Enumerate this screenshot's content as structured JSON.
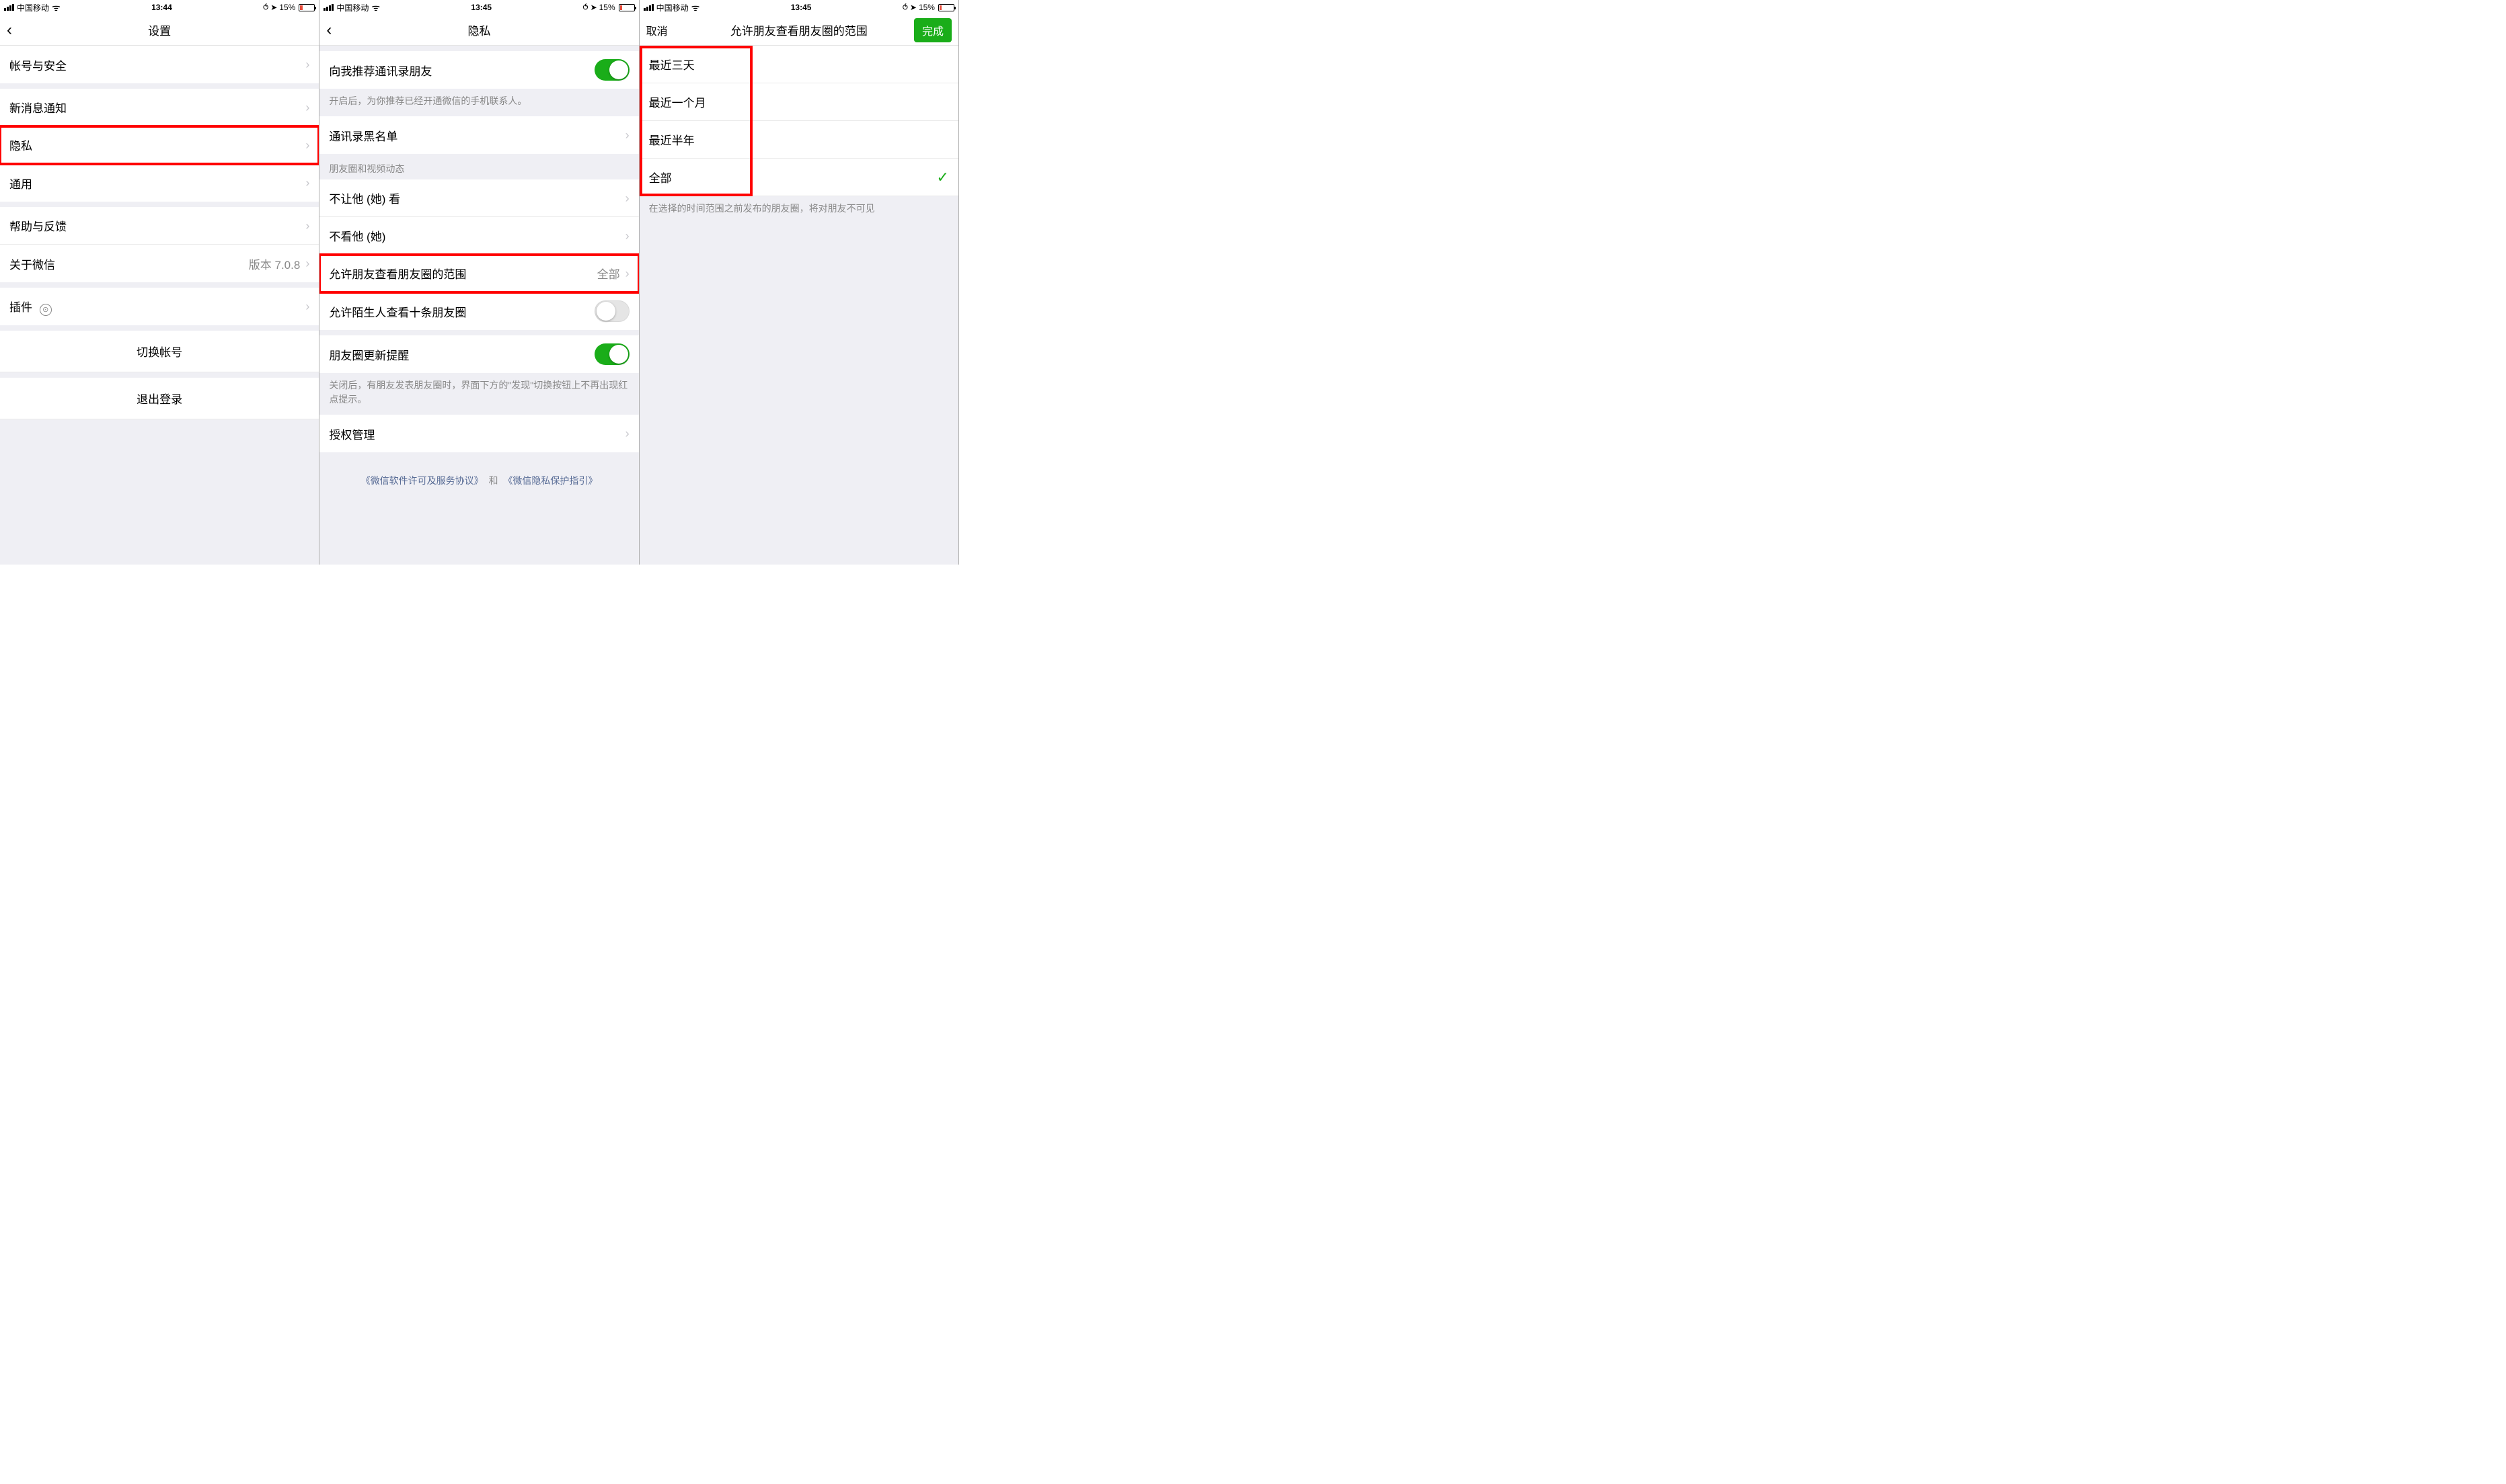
{
  "statusbar": {
    "carrier": "中国移动",
    "battery_pct": "15%",
    "battery_width": "15%",
    "time1": "13:44",
    "time2": "13:45",
    "time3": "13:45"
  },
  "icons": {
    "chevron_right": "›",
    "chevron_left": "‹",
    "wifi": "ᯤ",
    "lock_rotation": "⥀",
    "location": "➤",
    "check": "✓"
  },
  "screen1": {
    "title": "设置",
    "items": {
      "account": "帐号与安全",
      "notifications": "新消息通知",
      "privacy": "隐私",
      "general": "通用",
      "help": "帮助与反馈",
      "about": "关于微信",
      "about_value": "版本 7.0.8",
      "plugins": "插件",
      "switch": "切换帐号",
      "logout": "退出登录"
    }
  },
  "screen2": {
    "title": "隐私",
    "recommend": "向我推荐通讯录朋友",
    "recommend_note": "开启后，为你推荐已经开通微信的手机联系人。",
    "blacklist": "通讯录黑名单",
    "section_moments": "朋友圈和视频动态",
    "hide_my": "不让他 (她) 看",
    "hide_their": "不看他 (她)",
    "range": "允许朋友查看朋友圈的范围",
    "range_value": "全部",
    "strangers": "允许陌生人查看十条朋友圈",
    "moments_notify": "朋友圈更新提醒",
    "moments_notify_note": "关闭后，有朋友发表朋友圈时，界面下方的\"发现\"切换按钮上不再出现红点提示。",
    "auth": "授权管理",
    "legal1": "《微信软件许可及服务协议》",
    "legal_sep": "和",
    "legal2": "《微信隐私保护指引》"
  },
  "screen3": {
    "cancel": "取消",
    "title": "允许朋友查看朋友圈的范围",
    "done": "完成",
    "opt1": "最近三天",
    "opt2": "最近一个月",
    "opt3": "最近半年",
    "opt4": "全部",
    "note": "在选择的时间范围之前发布的朋友圈，将对朋友不可见"
  }
}
